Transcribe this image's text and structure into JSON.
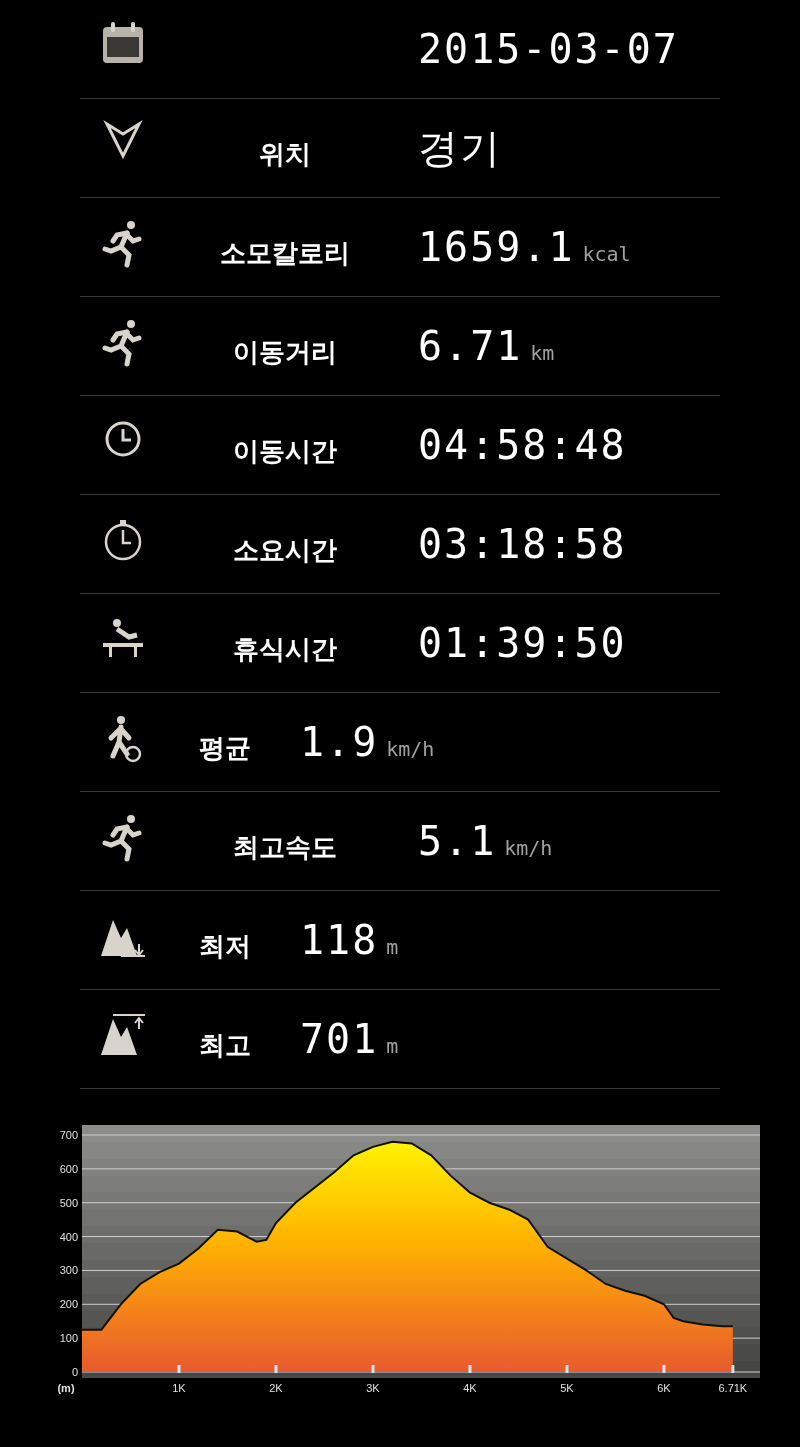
{
  "rows": [
    {
      "kind": "wide",
      "value": "2015-03-07"
    },
    {
      "kind": "wide",
      "label": "위치",
      "value": "경기"
    },
    {
      "kind": "wide",
      "label": "소모칼로리",
      "value": "1659.1",
      "unit": "kcal"
    },
    {
      "kind": "wide",
      "label": "이동거리",
      "value": "6.71",
      "unit": "km"
    },
    {
      "kind": "wide",
      "label": "이동시간",
      "value": "04:58:48"
    },
    {
      "kind": "wide",
      "label": "소요시간",
      "value": "03:18:58"
    },
    {
      "kind": "wide",
      "label": "휴식시간",
      "value": "01:39:50"
    },
    {
      "kind": "narrow",
      "label": "평균",
      "value": "1.9",
      "unit": "km/h"
    },
    {
      "kind": "wide",
      "label": "최고속도",
      "value": "5.1",
      "unit": "km/h"
    },
    {
      "kind": "narrow",
      "label": "최저",
      "value": "118",
      "unit": "m"
    },
    {
      "kind": "narrow",
      "label": "최고",
      "value": "701",
      "unit": "m"
    }
  ],
  "elevation": {
    "chart_data": {
      "type": "area",
      "grid": true,
      "ylabel": "(m)",
      "xlim": [
        0,
        6.99
      ],
      "ylim": [
        0,
        700
      ],
      "yticks": [
        0,
        100,
        200,
        300,
        400,
        500,
        600,
        700
      ],
      "xticks": [
        {
          "value": 1,
          "label": "1K"
        },
        {
          "value": 2,
          "label": "2K"
        },
        {
          "value": 3,
          "label": "3K"
        },
        {
          "value": 4,
          "label": "4K"
        },
        {
          "value": 5,
          "label": "5K"
        },
        {
          "value": 6,
          "label": "6K"
        },
        {
          "value": 6.71,
          "label": "6.71K"
        }
      ],
      "x": [
        0,
        0.2,
        0.4,
        0.6,
        0.8,
        1.0,
        1.2,
        1.4,
        1.6,
        1.8,
        1.9,
        2.0,
        2.2,
        2.4,
        2.6,
        2.8,
        3.0,
        3.2,
        3.4,
        3.6,
        3.8,
        4.0,
        4.2,
        4.4,
        4.6,
        4.8,
        5.0,
        5.2,
        5.4,
        5.6,
        5.8,
        6.0,
        6.1,
        6.2,
        6.4,
        6.6,
        6.71
      ],
      "series": [
        {
          "color": "#ffb000",
          "values": [
            125,
            125,
            200,
            260,
            295,
            320,
            365,
            420,
            415,
            385,
            390,
            440,
            500,
            545,
            590,
            640,
            665,
            680,
            675,
            640,
            580,
            530,
            500,
            480,
            450,
            370,
            335,
            300,
            260,
            240,
            225,
            200,
            160,
            150,
            140,
            135,
            135
          ]
        }
      ]
    }
  }
}
